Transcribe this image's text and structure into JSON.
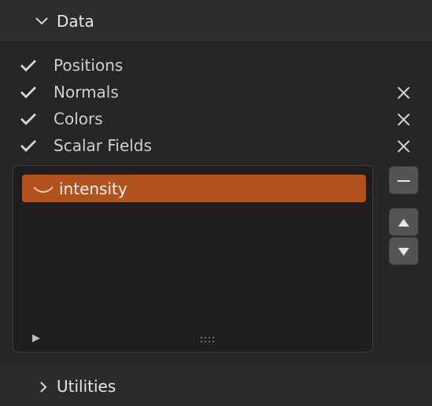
{
  "panel": {
    "title": "Data"
  },
  "attributes": [
    {
      "label": "Positions",
      "checked": true,
      "removable": false
    },
    {
      "label": "Normals",
      "checked": true,
      "removable": true
    },
    {
      "label": "Colors",
      "checked": true,
      "removable": true
    },
    {
      "label": "Scalar Fields",
      "checked": true,
      "removable": true
    }
  ],
  "scalar_list": {
    "items": [
      {
        "label": "intensity",
        "selected": true,
        "icon": "scalar-field-icon"
      }
    ],
    "grip": "::::"
  },
  "footer": {
    "title": "Utilities"
  },
  "colors": {
    "accent": "#b2521f",
    "panel": "#262626",
    "header": "#2d2d2d",
    "list_bg": "#1e1e1e"
  }
}
